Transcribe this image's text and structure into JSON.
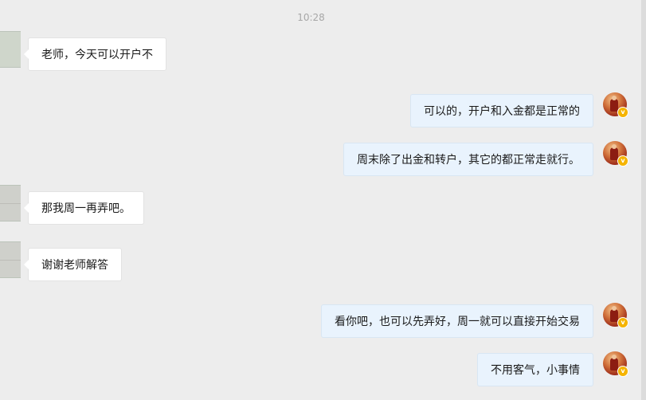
{
  "chat": {
    "timestamp": "10:28",
    "messages": [
      {
        "side": "left",
        "text": "老师，今天可以开户不"
      },
      {
        "side": "right",
        "text": "可以的，开户和入金都是正常的"
      },
      {
        "side": "right",
        "text": "周末除了出金和转户，其它的都正常走就行。"
      },
      {
        "side": "left",
        "text": "那我周一再弄吧。"
      },
      {
        "side": "left",
        "text": "谢谢老师解答"
      },
      {
        "side": "right",
        "text": "看你吧，也可以先弄好，周一就可以直接开始交易"
      },
      {
        "side": "right",
        "text": "不用客气，小事情"
      }
    ]
  },
  "avatar": {
    "verified_badge": "v"
  }
}
